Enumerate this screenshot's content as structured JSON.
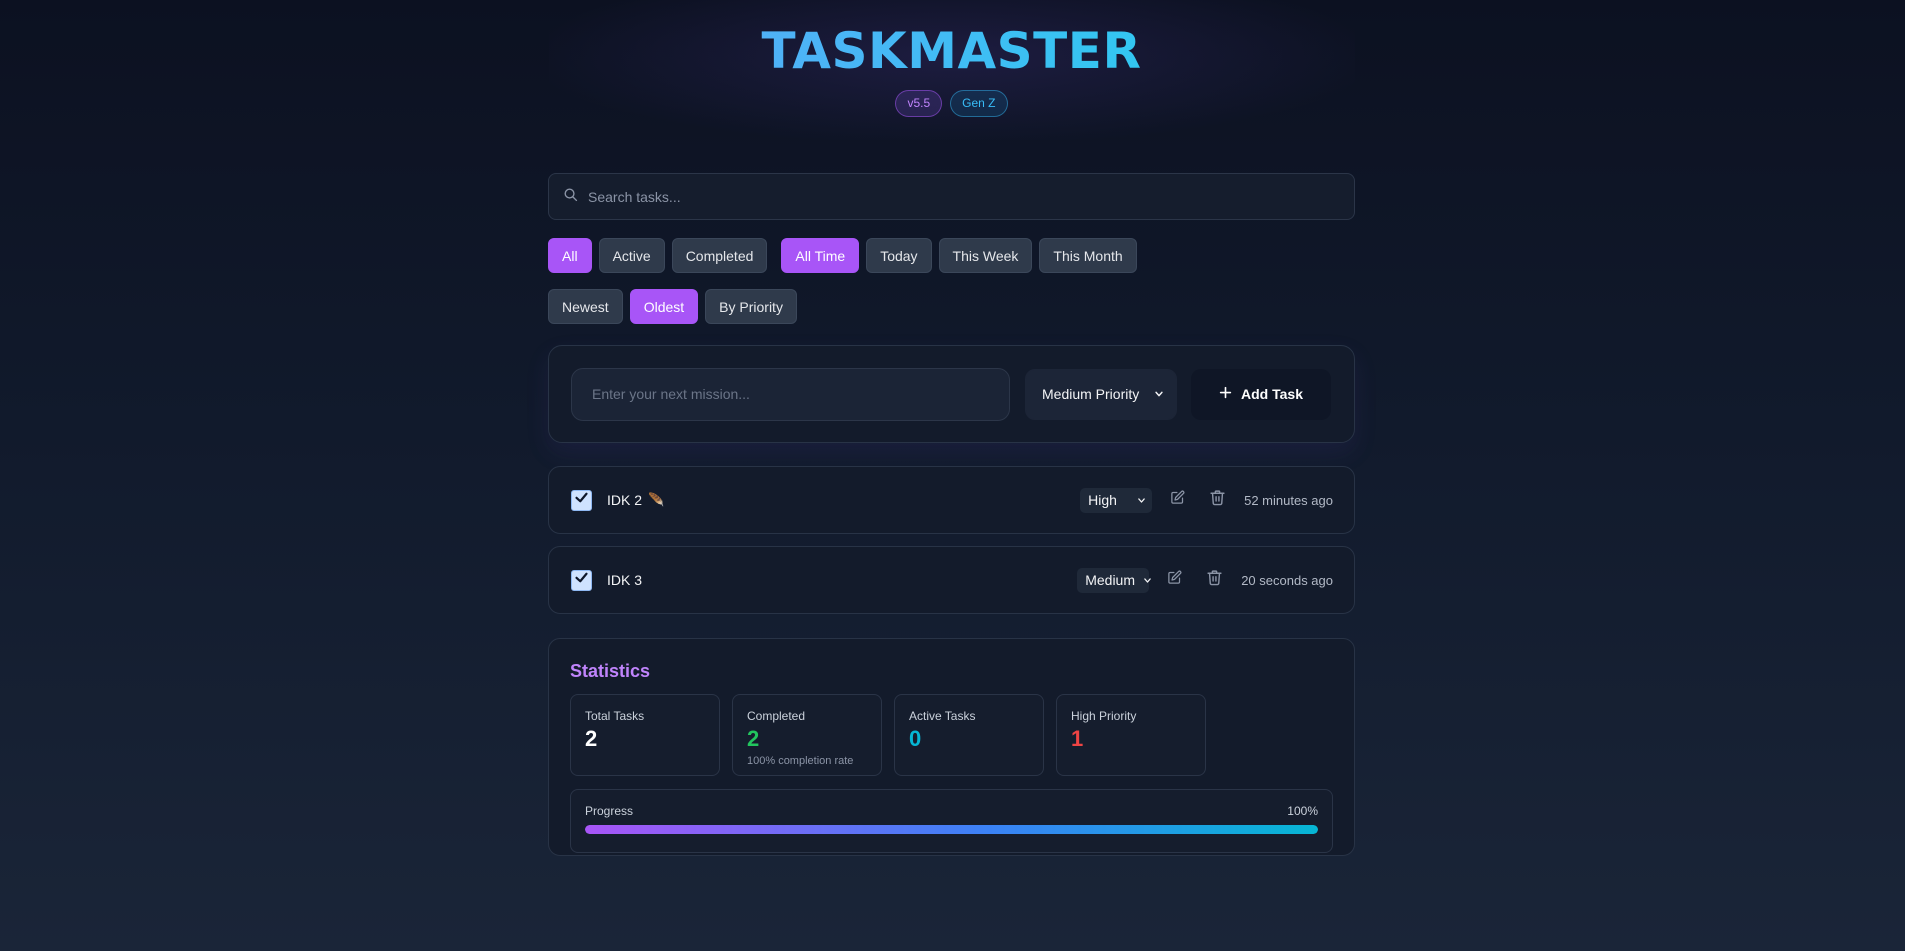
{
  "header": {
    "title": "TASKMASTER",
    "badges": {
      "version": "v5.5",
      "tag": "Gen Z"
    }
  },
  "search": {
    "placeholder": "Search tasks...",
    "value": ""
  },
  "filters": {
    "status": [
      "All",
      "Active",
      "Completed"
    ],
    "status_active": "All",
    "time": [
      "All Time",
      "Today",
      "This Week",
      "This Month"
    ],
    "time_active": "All Time",
    "sort": [
      "Newest",
      "Oldest",
      "By Priority"
    ],
    "sort_active": "Oldest"
  },
  "add_task": {
    "placeholder": "Enter your next mission...",
    "value": "",
    "priority": "Medium Priority",
    "button_label": "Add Task"
  },
  "tasks": [
    {
      "title": "IDK 2",
      "emoji": "🪶",
      "completed": true,
      "priority": "High",
      "time": "52 minutes ago"
    },
    {
      "title": "IDK 3",
      "emoji": "",
      "completed": true,
      "priority": "Medium",
      "time": "20 seconds ago"
    }
  ],
  "statistics": {
    "title": "Statistics",
    "total": {
      "label": "Total Tasks",
      "value": "2"
    },
    "completed": {
      "label": "Completed",
      "value": "2",
      "sub": "100% completion rate"
    },
    "active": {
      "label": "Active Tasks",
      "value": "0"
    },
    "high_priority": {
      "label": "High Priority",
      "value": "1"
    },
    "progress": {
      "label": "Progress",
      "value_text": "100%",
      "fraction": 1.0
    }
  },
  "colors": {
    "accent": "#a855f7",
    "completed_value": "#22c55e",
    "active_value": "#06b6d4",
    "high_priority_value": "#ef4444",
    "stats_title": "#c084fc"
  },
  "icons": {
    "search": "search-icon",
    "add": "plus-icon",
    "checkbox": "checkmark-icon",
    "edit": "edit-icon",
    "delete": "trash-icon",
    "dropdown": "chevron-down-icon"
  }
}
